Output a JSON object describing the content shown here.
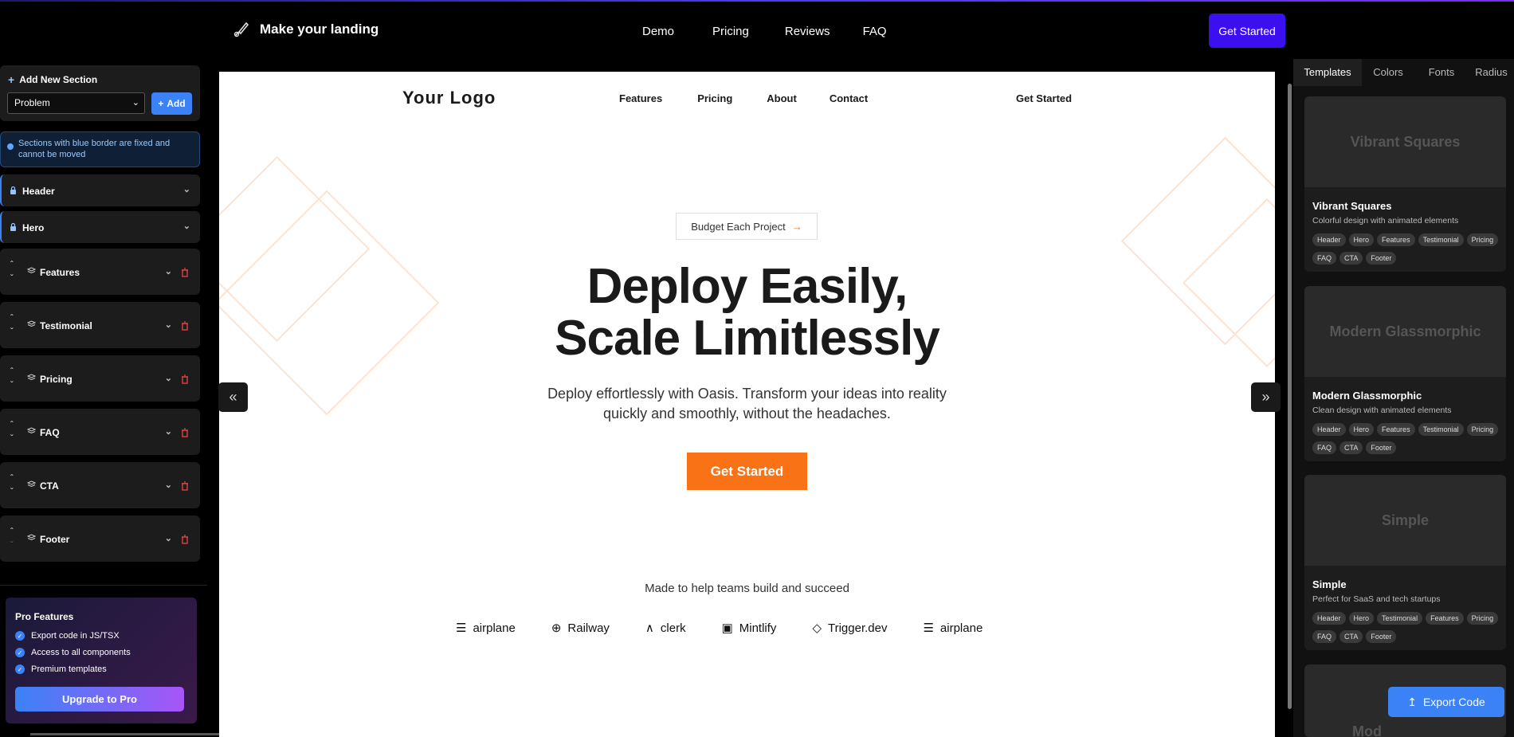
{
  "topnav": {
    "brand": "Make your landing",
    "links": [
      "Demo",
      "Pricing",
      "Reviews",
      "FAQ"
    ],
    "cta": "Get Started"
  },
  "sidebar": {
    "add_title": "Add New Section",
    "select_value": "Problem",
    "add_label": "Add",
    "info": "Sections with blue border are fixed and cannot be moved",
    "fixed_sections": [
      "Header",
      "Hero"
    ],
    "movable_sections": [
      "Features",
      "Testimonial",
      "Pricing",
      "FAQ",
      "CTA",
      "Footer"
    ],
    "pro": {
      "title": "Pro Features",
      "items": [
        "Export code in JS/TSX",
        "Access to all components",
        "Premium templates"
      ],
      "button": "Upgrade to Pro"
    }
  },
  "preview": {
    "logo": "Your Logo",
    "nav": [
      "Features",
      "Pricing",
      "About",
      "Contact"
    ],
    "nav_cta": "Get Started",
    "badge": "Budget Each Project",
    "headline_1": "Deploy Easily,",
    "headline_2": "Scale Limitlessly",
    "sub_1": "Deploy effortlessly with Oasis. Transform your ideas into reality",
    "sub_2": "quickly and smoothly, without the headaches.",
    "cta": "Get Started",
    "made": "Made to help teams build and succeed",
    "logos": [
      "airplane",
      "Railway",
      "clerk",
      "Mintlify",
      "Trigger.dev",
      "airplane"
    ],
    "accent": "#f97316"
  },
  "right_panel": {
    "tabs": [
      "Templates",
      "Colors",
      "Fonts",
      "Radius"
    ],
    "templates": [
      {
        "preview": "Vibrant Squares",
        "name": "Vibrant Squares",
        "desc": "Colorful design with animated elements",
        "chips": [
          "Header",
          "Hero",
          "Features",
          "Testimonial",
          "Pricing",
          "FAQ",
          "CTA",
          "Footer"
        ]
      },
      {
        "preview": "Modern Glassmorphic",
        "name": "Modern Glassmorphic",
        "desc": "Clean design with animated elements",
        "chips": [
          "Header",
          "Hero",
          "Features",
          "Testimonial",
          "Pricing",
          "FAQ",
          "CTA",
          "Footer"
        ]
      },
      {
        "preview": "Simple",
        "name": "Simple",
        "desc": "Perfect for SaaS and tech startups",
        "chips": [
          "Header",
          "Hero",
          "Testimonial",
          "Features",
          "Pricing",
          "FAQ",
          "CTA",
          "Footer"
        ]
      },
      {
        "preview": "Mod"
      }
    ],
    "export": "Export Code"
  }
}
